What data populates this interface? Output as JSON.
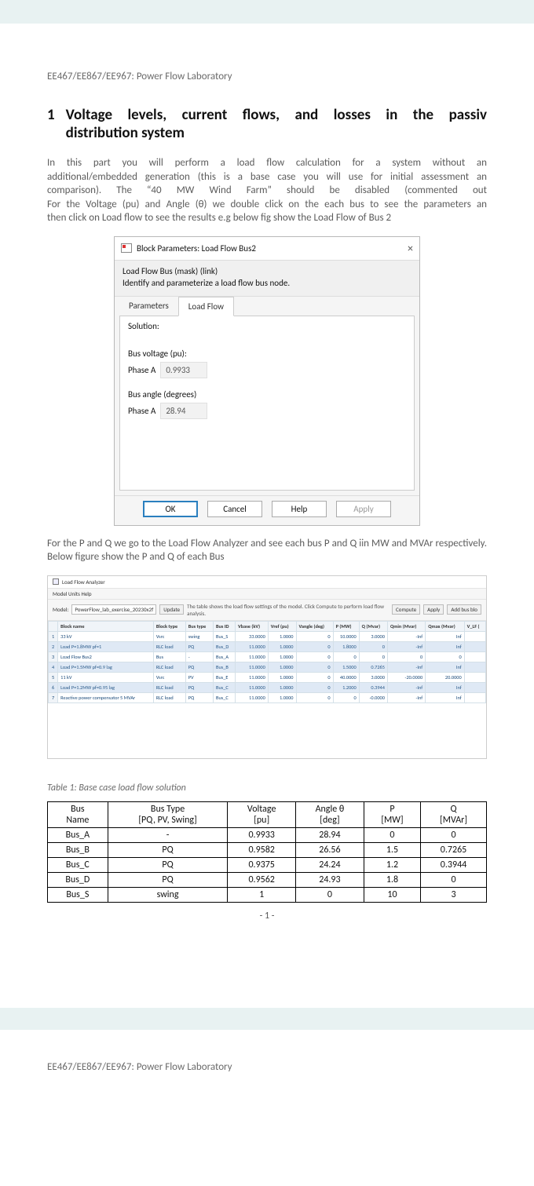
{
  "header": {
    "running": "EE467/EE867/EE967: Power Flow Laboratory"
  },
  "section": {
    "num": "1",
    "title_l1": "Voltage levels, current flows, and losses in the passiv",
    "title_l2": "distribution system"
  },
  "para1": {
    "l1": "In this part you will perform a load flow calculation for a system without an",
    "l2": "additional/embedded generation (this is a base case you will use for initial assessment an",
    "l3": "comparison). The “40 MW Wind Farm” should be disabled (commented out",
    "l4": "For the Voltage (pu) and Angle (θ) we double click on the each bus to see the parameters an",
    "l5": "then click on Load flow to see the results e.g below fig show the Load Flow of Bus 2"
  },
  "dialog": {
    "title": "Block Parameters: Load Flow Bus2",
    "close": "×",
    "mask": "Load Flow Bus (mask) (link)",
    "desc": "Identify and parameterize a load flow bus node.",
    "tab_params": "Parameters",
    "tab_loadflow": "Load Flow",
    "solution": "Solution:",
    "bv_label": "Bus voltage (pu):",
    "bv_phase": "Phase A",
    "bv_value": "0.9933",
    "ba_label": "Bus angle (degrees)",
    "ba_phase": "Phase A",
    "ba_value": "28.94",
    "ok": "OK",
    "cancel": "Cancel",
    "help": "Help",
    "apply": "Apply"
  },
  "para2": "For the P and Q we go to the  Load Flow Analyzer and see each bus P and Q iin MW and MVAr respectively. Below figure show the P and Q of each Bus",
  "analyzer": {
    "title": "Load Flow Analyzer",
    "menu": "Model  Units  Help",
    "model_lbl": "Model:",
    "model_val": "PowerFlow_lab_exercise_20230x2f",
    "update": "Update",
    "msg": "The table shows the load flow settings of the model.  Click Compute to perform load flow analysis.",
    "compute": "Compute",
    "apply": "Apply",
    "add": "Add bus blo",
    "headers": [
      "",
      "Block name",
      "Block type",
      "Bus type",
      "Bus ID",
      "Vbase (kV)",
      "Vref (pu)",
      "Vangle (deg)",
      "P (MW)",
      "Q (Mvar)",
      "Qmin (Mvar)",
      "Qmax (Mvar)",
      "V_LF ("
    ],
    "rows": [
      {
        "idx": "1",
        "name": "33 kV",
        "btype": "Vsrc",
        "bus": "swing",
        "id": "Bus_S",
        "vb": "33.0000",
        "vr": "1.0000",
        "va": "0",
        "p": "10.0000",
        "q": "3.0000",
        "qmin": "-Inf",
        "qmax": "Inf",
        "vlf": ""
      },
      {
        "idx": "2",
        "name": "Load P=1.8MW pf=1",
        "btype": "RLC load",
        "bus": "PQ",
        "id": "Bus_D",
        "vb": "11.0000",
        "vr": "1.0000",
        "va": "0",
        "p": "1.8000",
        "q": "0",
        "qmin": "-Inf",
        "qmax": "Inf",
        "vlf": ""
      },
      {
        "idx": "3",
        "name": "Load Flow Bus2",
        "btype": "Bus",
        "bus": "-",
        "id": "Bus_A",
        "vb": "11.0000",
        "vr": "1.0000",
        "va": "0",
        "p": "0",
        "q": "0",
        "qmin": "0",
        "qmax": "0",
        "vlf": ""
      },
      {
        "idx": "4",
        "name": "Load P=1.5MW pf=0.9 lag",
        "btype": "RLC load",
        "bus": "PQ",
        "id": "Bus_B",
        "vb": "11.0000",
        "vr": "1.0000",
        "va": "0",
        "p": "1.5000",
        "q": "0.7265",
        "qmin": "-Inf",
        "qmax": "Inf",
        "vlf": ""
      },
      {
        "idx": "5",
        "name": "11 kV",
        "btype": "Vsrc",
        "bus": "PV",
        "id": "Bus_E",
        "vb": "11.0000",
        "vr": "1.0000",
        "va": "0",
        "p": "40.0000",
        "q": "3.0000",
        "qmin": "-20.0000",
        "qmax": "20.0000",
        "vlf": ""
      },
      {
        "idx": "6",
        "name": "Load P=1.2MW pf=0.95 lag",
        "btype": "RLC load",
        "bus": "PQ",
        "id": "Bus_C",
        "vb": "11.0000",
        "vr": "1.0000",
        "va": "0",
        "p": "1.2000",
        "q": "0.3944",
        "qmin": "-Inf",
        "qmax": "Inf",
        "vlf": ""
      },
      {
        "idx": "7",
        "name": "Reactive power compensator 5 MVAr",
        "btype": "RLC load",
        "bus": "PQ",
        "id": "Bus_C",
        "vb": "11.0000",
        "vr": "1.0000",
        "va": "0",
        "p": "0",
        "q": "-0.0000",
        "qmin": "-Inf",
        "qmax": "Inf",
        "vlf": ""
      }
    ]
  },
  "table1": {
    "caption": "Table 1: Base case load flow solution",
    "h": {
      "bus1": "Bus",
      "bus2": "Name",
      "type1": "Bus Type",
      "type2": "[PQ, PV, Swing]",
      "v1": "Voltage",
      "v2": "[pu]",
      "a1": "Angle θ",
      "a2": "[deg]",
      "p1": "P",
      "p2": "[MW]",
      "q1": "Q",
      "q2": "[MVAr]"
    },
    "rows": [
      {
        "bus": "Bus_A",
        "type": "-",
        "v": "0.9933",
        "a": "28.94",
        "p": "0",
        "q": "0"
      },
      {
        "bus": "Bus_B",
        "type": "PQ",
        "v": "0.9582",
        "a": "26.56",
        "p": "1.5",
        "q": "0.7265"
      },
      {
        "bus": "Bus_C",
        "type": "PQ",
        "v": "0.9375",
        "a": "24.24",
        "p": "1.2",
        "q": "0.3944"
      },
      {
        "bus": "Bus_D",
        "type": "PQ",
        "v": "0.9562",
        "a": "24.93",
        "p": "1.8",
        "q": "0"
      },
      {
        "bus": "Bus_S",
        "type": "swing",
        "v": "1",
        "a": "0",
        "p": "10",
        "q": "3"
      }
    ]
  },
  "chart_data": {
    "type": "table",
    "title": "Base case load flow solution",
    "columns": [
      "Bus Name",
      "Bus Type",
      "Voltage [pu]",
      "Angle θ [deg]",
      "P [MW]",
      "Q [MVAr]"
    ],
    "rows": [
      [
        "Bus_A",
        "-",
        0.9933,
        28.94,
        0,
        0
      ],
      [
        "Bus_B",
        "PQ",
        0.9582,
        26.56,
        1.5,
        0.7265
      ],
      [
        "Bus_C",
        "PQ",
        0.9375,
        24.24,
        1.2,
        0.3944
      ],
      [
        "Bus_D",
        "PQ",
        0.9562,
        24.93,
        1.8,
        0
      ],
      [
        "Bus_S",
        "swing",
        1,
        0,
        10,
        3
      ]
    ]
  },
  "pgnum": "- 1 -",
  "footer": {
    "running": "EE467/EE867/EE967: Power Flow Laboratory"
  }
}
